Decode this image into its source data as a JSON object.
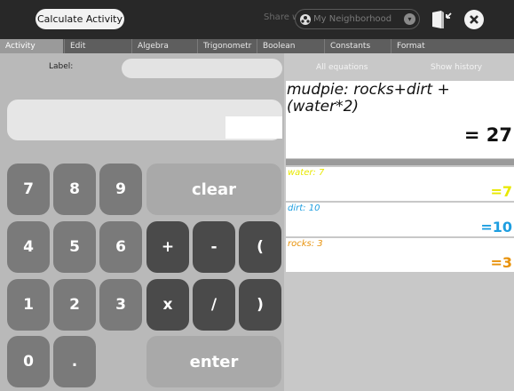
{
  "toolbar": {
    "activity_button": "Calculate Activity",
    "share_label": "Share with:",
    "share_value": "My Neighborhood",
    "icons": [
      "network-icon",
      "chevron-down-icon",
      "keep-journal-icon",
      "stop-icon"
    ]
  },
  "tabs": [
    {
      "label": "Activity",
      "active": true
    },
    {
      "label": "Edit",
      "active": false
    },
    {
      "label": "Algebra",
      "active": false
    },
    {
      "label": "Trigonometr",
      "active": false
    },
    {
      "label": "Boolean",
      "active": false
    },
    {
      "label": "Constants",
      "active": false
    },
    {
      "label": "Format",
      "active": false
    }
  ],
  "left": {
    "label_caption": "Label:",
    "label_value": "",
    "expression_value": ""
  },
  "keypad": {
    "keys": [
      "7",
      "8",
      "9",
      "clear",
      "4",
      "5",
      "6",
      "+",
      "-",
      "(",
      "1",
      "2",
      "3",
      "x",
      "/",
      ")",
      "0",
      ".",
      "enter"
    ]
  },
  "right": {
    "all_equations": "All equations",
    "show_history": "Show history",
    "result_expression": "mudpie: rocks+dirt +(water*2)",
    "result_value": "= 27",
    "variables": [
      {
        "label_name": "water",
        "label_value": ": 7",
        "result": "=7",
        "color": "#e8e800"
      },
      {
        "label_name": "dirt",
        "label_value": ": 10",
        "result": "=10",
        "color": "#1e9ee0"
      },
      {
        "label_name": "rocks",
        "label_value": ": 3",
        "result": "=3",
        "color": "#e8920a"
      }
    ]
  },
  "colors": {
    "toolbar": "#282828",
    "tabbar": "#5e5e5e",
    "key_gray": "#7a7a7a",
    "key_dark": "#4a4a4a"
  }
}
